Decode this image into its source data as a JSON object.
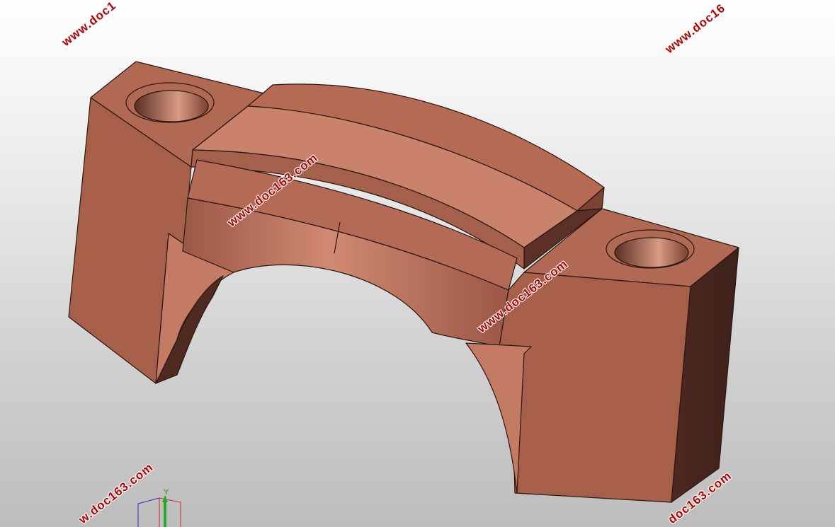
{
  "watermark": {
    "text": "www.doc163.com",
    "text_clipped_top_left": "www.doc1",
    "text_clipped_top_right": "www.doc16",
    "text_clipped_bottom_left": "w.doc163.com",
    "text_clipped_bottom_right": "doc163.com",
    "color": "#b30000"
  },
  "model": {
    "part": "bearing-cap",
    "face_colors": {
      "front": "#a65f49",
      "light": "#c9826a",
      "top": "#b56c55",
      "dark": "#4a2720",
      "edge": "#2b1510"
    }
  },
  "triad": {
    "y_label": "Y"
  }
}
